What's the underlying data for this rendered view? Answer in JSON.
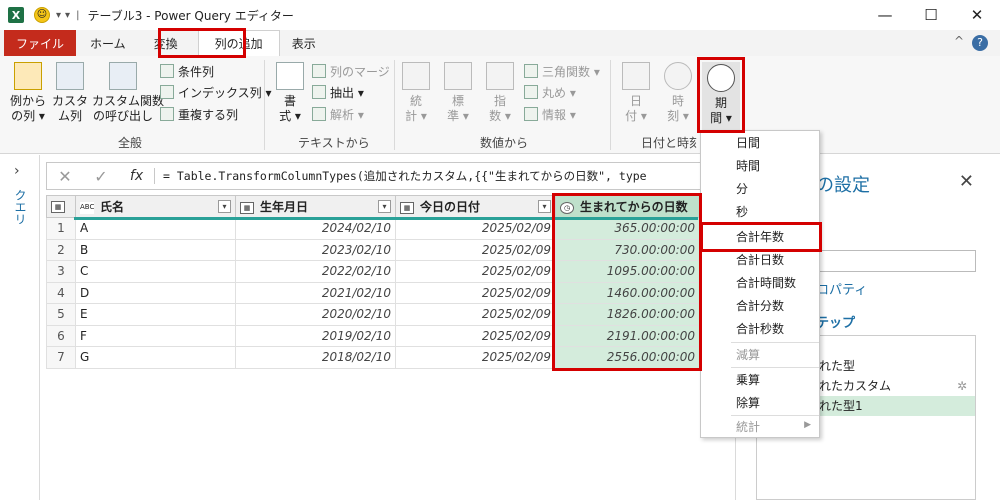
{
  "window": {
    "title": "テーブル3 - Power Query エディター",
    "app_icon": "X",
    "separator": "|"
  },
  "tabs": [
    {
      "label": "ファイル"
    },
    {
      "label": "ホーム"
    },
    {
      "label": "変換"
    },
    {
      "label": "列の追加"
    },
    {
      "label": "表示"
    }
  ],
  "ribbon": {
    "col_from_examples": "例から\nの列 ▾",
    "custom_col": "カスタ\nム列",
    "invoke_func": "カスタム関数\nの呼び出し",
    "conditional": "条件列",
    "index": "インデックス列 ▾",
    "duplicate": "重複する列",
    "group_general": "全般",
    "format": "書\n式 ▾",
    "merge": "列のマージ",
    "extract": "抽出 ▾",
    "parse": "解析 ▾",
    "group_text": "テキストから",
    "stats": "統\n計 ▾",
    "standard": "標\n準 ▾",
    "scientific": "指\n数 ▾",
    "trig": "三角関数 ▾",
    "round": "丸め ▾",
    "info": "情報 ▾",
    "group_number": "数値から",
    "date": "日\n付 ▾",
    "time": "時\n刻 ▾",
    "duration": "期\n間 ▾",
    "group_datetime": "日付と時刻から"
  },
  "left_pane": {
    "label": "クエリ",
    "arrow": "›"
  },
  "formula": {
    "fx": "fx",
    "text": "= Table.TransformColumnTypes(追加されたカスタム,{{\"生まれてからの日数\", type"
  },
  "table": {
    "headers": [
      "氏名",
      "生年月日",
      "今日の日付",
      "生まれてからの日数"
    ],
    "rows": [
      [
        "1",
        "A",
        "2024/02/10",
        "2025/02/09",
        "365.00:00:00"
      ],
      [
        "2",
        "B",
        "2023/02/10",
        "2025/02/09",
        "730.00:00:00"
      ],
      [
        "3",
        "C",
        "2022/02/10",
        "2025/02/09",
        "1095.00:00:00"
      ],
      [
        "4",
        "D",
        "2021/02/10",
        "2025/02/09",
        "1460.00:00:00"
      ],
      [
        "5",
        "E",
        "2020/02/10",
        "2025/02/09",
        "1826.00:00:00"
      ],
      [
        "6",
        "F",
        "2019/02/10",
        "2025/02/09",
        "2191.00:00:00"
      ],
      [
        "7",
        "G",
        "2018/02/10",
        "2025/02/09",
        "2556.00:00:00"
      ]
    ]
  },
  "settings": {
    "title": "の設定",
    "close": "✕",
    "props_link": "ロパティ",
    "steps_label": "テップ",
    "steps": [
      "れた型",
      "れたカスタム",
      "れた型1"
    ],
    "gear": "✲"
  },
  "dropdown": {
    "items": [
      "日間",
      "時間",
      "分",
      "秒",
      "合計年数",
      "合計日数",
      "合計時間数",
      "合計分数",
      "合計秒数",
      "減算",
      "乗算",
      "除算",
      "統計"
    ]
  },
  "accent": {
    "excel": "#1e7145",
    "file_tab": "#c42b1c",
    "highlight": "#d40000",
    "selected": "#d4ecdc"
  }
}
